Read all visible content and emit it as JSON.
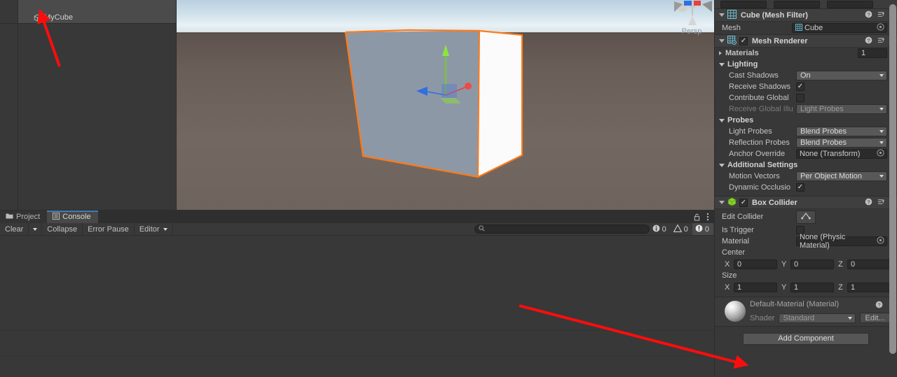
{
  "hierarchy": {
    "items": [
      {
        "label": "MyCube",
        "icon": "cube-icon",
        "selected": true
      }
    ]
  },
  "scene": {
    "projection_label": "Persp",
    "gizmo_axes": [
      "x",
      "y",
      "z"
    ],
    "selection_outline_color": "#ff7a18",
    "cube_front_color": "#8d98a7",
    "cube_right_color": "#fbfbfb"
  },
  "console": {
    "tabs": [
      {
        "label": "Project",
        "icon": "folder-icon",
        "active": false
      },
      {
        "label": "Console",
        "icon": "list-icon",
        "active": true
      }
    ],
    "toolbar": {
      "clear_label": "Clear",
      "collapse_label": "Collapse",
      "error_pause_label": "Error Pause",
      "editor_label": "Editor"
    },
    "search": {
      "value": "",
      "placeholder": "",
      "icon": "search-icon"
    },
    "counters": {
      "info": "0",
      "warning": "0",
      "error": "0"
    },
    "panel_icons": [
      "lock-icon",
      "kebab-menu-icon"
    ]
  },
  "inspector": {
    "mesh_filter": {
      "title": "Cube (Mesh Filter)",
      "icon": "mesh-filter-icon",
      "mesh_label": "Mesh",
      "mesh_value": "Cube",
      "header_icons": [
        "help-icon",
        "preset-icon",
        "kebab-menu-icon"
      ]
    },
    "mesh_renderer": {
      "title": "Mesh Renderer",
      "icon": "mesh-renderer-icon",
      "enabled": true,
      "header_icons": [
        "help-icon",
        "preset-icon",
        "kebab-menu-icon"
      ],
      "materials_label": "Materials",
      "materials_count": "1",
      "lighting_label": "Lighting",
      "cast_shadows_label": "Cast Shadows",
      "cast_shadows_value": "On",
      "receive_shadows_label": "Receive Shadows",
      "receive_shadows_checked": true,
      "contribute_global_label": "Contribute Global",
      "contribute_global_checked": false,
      "receive_gi_label": "Receive Global Illu",
      "receive_gi_value": "Light Probes",
      "probes_label": "Probes",
      "light_probes_label": "Light Probes",
      "light_probes_value": "Blend Probes",
      "reflection_probes_label": "Reflection Probes",
      "reflection_probes_value": "Blend Probes",
      "anchor_override_label": "Anchor Override",
      "anchor_override_value": "None (Transform)",
      "additional_settings_label": "Additional Settings",
      "motion_vectors_label": "Motion Vectors",
      "motion_vectors_value": "Per Object Motion",
      "dynamic_occlusion_label": "Dynamic Occlusio",
      "dynamic_occlusion_checked": true
    },
    "box_collider": {
      "title": "Box Collider",
      "icon": "box-collider-icon",
      "enabled": true,
      "header_icons": [
        "help-icon",
        "preset-icon",
        "kebab-menu-icon"
      ],
      "edit_collider_label": "Edit Collider",
      "edit_collider_icon": "collider-edit-icon",
      "is_trigger_label": "Is Trigger",
      "is_trigger_checked": false,
      "material_label": "Material",
      "material_value": "None (Physic Material)",
      "center_label": "Center",
      "center": {
        "x": "0",
        "y": "0",
        "z": "0"
      },
      "size_label": "Size",
      "size": {
        "x": "1",
        "y": "1",
        "z": "1"
      },
      "axis_labels": {
        "x": "X",
        "y": "Y",
        "z": "Z"
      }
    },
    "material_preview": {
      "title": "Default-Material (Material)",
      "shader_label": "Shader",
      "shader_value": "Standard",
      "edit_label": "Edit...",
      "header_icons": [
        "help-icon",
        "kebab-menu-icon"
      ]
    },
    "add_component_label": "Add Component"
  },
  "annotations": {
    "arrow_color": "#fb0d0d",
    "arrows": [
      {
        "name": "arrow-to-mycube",
        "target": "MyCube"
      },
      {
        "name": "arrow-to-add-component",
        "target": "Add Component"
      }
    ]
  }
}
